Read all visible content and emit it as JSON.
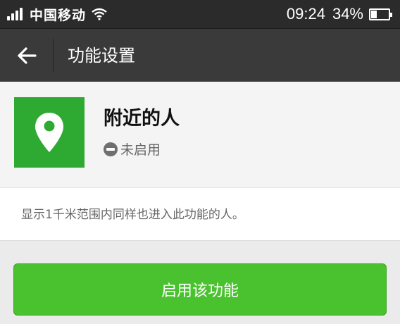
{
  "status_bar": {
    "carrier": "中国移动",
    "time": "09:24",
    "battery": "34%",
    "battery_level": 0.34
  },
  "nav": {
    "title": "功能设置",
    "back_icon": "arrow-left-icon"
  },
  "feature": {
    "name": "附近的人",
    "icon": "location-pin-icon",
    "icon_color": "#2eaa32",
    "status_icon": "disabled-circle-icon",
    "status": "未启用"
  },
  "description": "显示1千米范围内同样也进入此功能的人。",
  "enable_button": {
    "label": "启用该功能",
    "color": "#4ac22f"
  }
}
